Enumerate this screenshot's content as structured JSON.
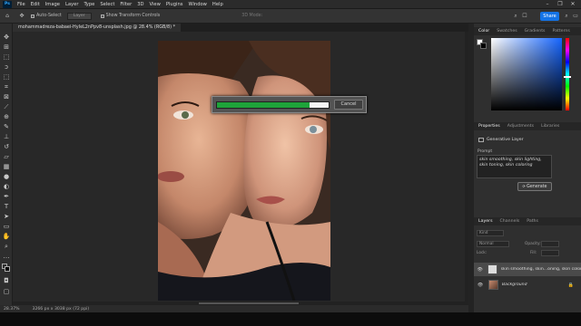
{
  "menubar": {
    "app": "Ps",
    "items": [
      "File",
      "Edit",
      "Image",
      "Layer",
      "Type",
      "Select",
      "Filter",
      "3D",
      "View",
      "Plugins",
      "Window",
      "Help"
    ]
  },
  "options": {
    "auto_select": "Auto-Select",
    "layer_select": "Layer",
    "transform_controls": "Show Transform Controls",
    "mode_3d": "3D Mode:",
    "share": "Share"
  },
  "document": {
    "tab_title": "mohammadreza-babaei-HyIeL2nPpv8-unsplash.jpg @ 28.4% (RGB/8) *"
  },
  "progress_dialog": {
    "progress": 0.83,
    "cancel_label": "Cancel"
  },
  "status": {
    "zoom": "28.37%",
    "doc_size": "3266 px x 3038 px (72 ppi)"
  },
  "color_panel": {
    "tabs": [
      "Color",
      "Swatches",
      "Gradients",
      "Patterns"
    ],
    "foreground": "#ffffff",
    "background": "#000000",
    "hue_color": "#1565ff"
  },
  "properties_panel": {
    "tabs": [
      "Properties",
      "Adjustments",
      "Libraries"
    ],
    "layer_type": "Generative Layer",
    "prompt_label": "Prompt",
    "prompt_text": "skin smoothing, skin lighting, skin toning, skin coloring",
    "generate_label": "Generate"
  },
  "layers_panel": {
    "tabs": [
      "Layers",
      "Channels",
      "Paths"
    ],
    "filter_placeholder": "Kind",
    "blend_mode": "Normal",
    "opacity_label": "Opacity:",
    "lock_label": "Lock:",
    "fill_label": "Fill:",
    "layers": [
      {
        "name": "skin smoothing, skin...oning, skin coloring"
      },
      {
        "name": "Background"
      }
    ]
  },
  "icons": [
    "move-icon",
    "artboard-icon",
    "marquee-icon",
    "lasso-icon",
    "object-select-icon",
    "crop-icon",
    "frame-icon",
    "eyedropper-icon",
    "healing-icon",
    "brush-icon",
    "stamp-icon",
    "history-brush-icon",
    "eraser-icon",
    "gradient-icon",
    "blur-icon",
    "dodge-icon",
    "pen-icon",
    "type-icon",
    "path-select-icon",
    "rectangle-icon",
    "hand-icon",
    "zoom-icon",
    "more-tools-icon"
  ]
}
